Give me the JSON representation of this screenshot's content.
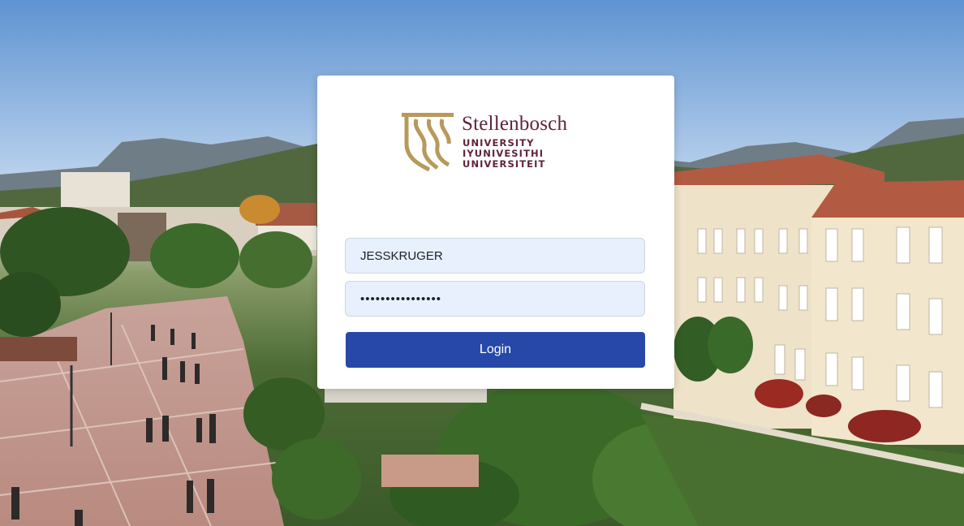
{
  "brand": {
    "name": "Stellenbosch",
    "subtitle_lines": [
      "UNIVERSITY",
      "IYUNIVESITHI",
      "UNIVERSITEIT"
    ],
    "primary_color": "#61223b",
    "accent_color": "#b79a5b"
  },
  "login_form": {
    "username_value": "JESSKRUGER",
    "password_value": "••••••••••••••••",
    "login_button_label": "Login",
    "button_color": "#2748a8",
    "field_background": "#e8f0fe"
  },
  "background": {
    "description_icon": "campus-photo"
  }
}
